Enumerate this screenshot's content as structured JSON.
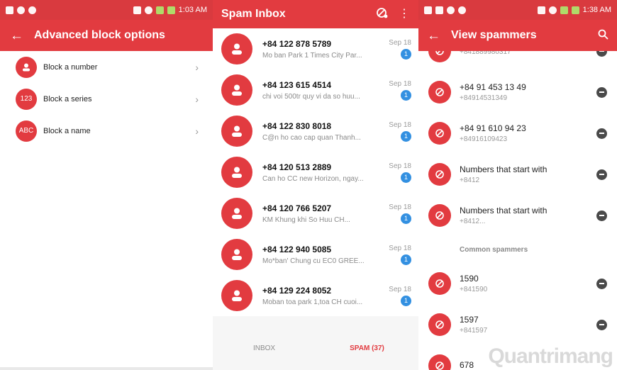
{
  "panel1": {
    "status_time": "1:03 AM",
    "title": "Advanced block options",
    "options": [
      {
        "badge": "",
        "label": "Block a number"
      },
      {
        "badge": "123",
        "label": "Block a series"
      },
      {
        "badge": "ABC",
        "label": "Block a name"
      }
    ]
  },
  "panel2": {
    "title": "Spam Inbox",
    "messages": [
      {
        "number": "+84 122 878 5789",
        "preview": "Mo ban Park 1 Times City Par...",
        "date": "Sep 18",
        "count": "1"
      },
      {
        "number": "+84 123 615 4514",
        "preview": "chi voi 500tr quy vi da so huu...",
        "date": "Sep 18",
        "count": "1"
      },
      {
        "number": "+84 122 830 8018",
        "preview": "C@n ho cao cap quan Thanh...",
        "date": "Sep 18",
        "count": "1"
      },
      {
        "number": "+84 120 513 2889",
        "preview": "Can ho CC new Horizon, ngay...",
        "date": "Sep 18",
        "count": "1"
      },
      {
        "number": "+84 120 766 5207",
        "preview": "KM Khung khi So Huu CH...",
        "date": "Sep 18",
        "count": "1"
      },
      {
        "number": "+84 122 940 5085",
        "preview": "Mo*ban' Chung cu EC0 GREE...",
        "date": "Sep 18",
        "count": "1"
      },
      {
        "number": "+84 129 224 8052",
        "preview": "Moban toa park 1,toa CH cuoi...",
        "date": "Sep 18",
        "count": "1"
      }
    ],
    "tabs": {
      "inbox": "INBOX",
      "spam": "SPAM (37)"
    }
  },
  "panel3": {
    "status_time": "1:38 AM",
    "title": "View spammers",
    "spammers": [
      {
        "title": "",
        "sub": "+841889980317"
      },
      {
        "title": "+84 91 453 13 49",
        "sub": "+84914531349"
      },
      {
        "title": "+84 91 610 94 23",
        "sub": "+84916109423"
      },
      {
        "title": "Numbers that start with",
        "sub": "+8412"
      },
      {
        "title": "Numbers that start with",
        "sub": "+8412..."
      }
    ],
    "section_label": "Common spammers",
    "common": [
      {
        "title": "1590",
        "sub": "+841590"
      },
      {
        "title": "1597",
        "sub": "+841597"
      },
      {
        "title": "678",
        "sub": ""
      }
    ]
  },
  "watermark": "Quantrimang",
  "colors": {
    "accent": "#e23b40",
    "badge_blue": "#3390e1",
    "remove": "#4a4a4a"
  }
}
